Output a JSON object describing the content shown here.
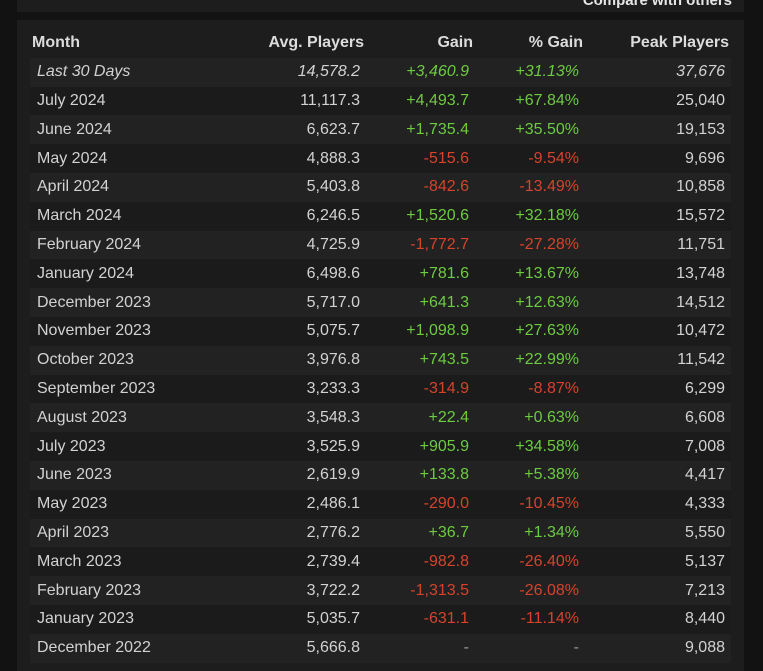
{
  "header_link": "Compare with others",
  "table": {
    "headers": {
      "month": "Month",
      "avg": "Avg. Players",
      "gain": "Gain",
      "pct": "% Gain",
      "peak": "Peak Players"
    },
    "rows": [
      {
        "month": "Last 30 Days",
        "avg": "14,578.2",
        "gain": "+3,460.9",
        "pct": "+31.13%",
        "peak": "37,676",
        "trend": "pos",
        "italic": true
      },
      {
        "month": "July 2024",
        "avg": "11,117.3",
        "gain": "+4,493.7",
        "pct": "+67.84%",
        "peak": "25,040",
        "trend": "pos"
      },
      {
        "month": "June 2024",
        "avg": "6,623.7",
        "gain": "+1,735.4",
        "pct": "+35.50%",
        "peak": "19,153",
        "trend": "pos"
      },
      {
        "month": "May 2024",
        "avg": "4,888.3",
        "gain": "-515.6",
        "pct": "-9.54%",
        "peak": "9,696",
        "trend": "neg"
      },
      {
        "month": "April 2024",
        "avg": "5,403.8",
        "gain": "-842.6",
        "pct": "-13.49%",
        "peak": "10,858",
        "trend": "neg"
      },
      {
        "month": "March 2024",
        "avg": "6,246.5",
        "gain": "+1,520.6",
        "pct": "+32.18%",
        "peak": "15,572",
        "trend": "pos"
      },
      {
        "month": "February 2024",
        "avg": "4,725.9",
        "gain": "-1,772.7",
        "pct": "-27.28%",
        "peak": "11,751",
        "trend": "neg"
      },
      {
        "month": "January 2024",
        "avg": "6,498.6",
        "gain": "+781.6",
        "pct": "+13.67%",
        "peak": "13,748",
        "trend": "pos"
      },
      {
        "month": "December 2023",
        "avg": "5,717.0",
        "gain": "+641.3",
        "pct": "+12.63%",
        "peak": "14,512",
        "trend": "pos"
      },
      {
        "month": "November 2023",
        "avg": "5,075.7",
        "gain": "+1,098.9",
        "pct": "+27.63%",
        "peak": "10,472",
        "trend": "pos"
      },
      {
        "month": "October 2023",
        "avg": "3,976.8",
        "gain": "+743.5",
        "pct": "+22.99%",
        "peak": "11,542",
        "trend": "pos"
      },
      {
        "month": "September 2023",
        "avg": "3,233.3",
        "gain": "-314.9",
        "pct": "-8.87%",
        "peak": "6,299",
        "trend": "neg"
      },
      {
        "month": "August 2023",
        "avg": "3,548.3",
        "gain": "+22.4",
        "pct": "+0.63%",
        "peak": "6,608",
        "trend": "pos"
      },
      {
        "month": "July 2023",
        "avg": "3,525.9",
        "gain": "+905.9",
        "pct": "+34.58%",
        "peak": "7,008",
        "trend": "pos"
      },
      {
        "month": "June 2023",
        "avg": "2,619.9",
        "gain": "+133.8",
        "pct": "+5.38%",
        "peak": "4,417",
        "trend": "pos"
      },
      {
        "month": "May 2023",
        "avg": "2,486.1",
        "gain": "-290.0",
        "pct": "-10.45%",
        "peak": "4,333",
        "trend": "neg"
      },
      {
        "month": "April 2023",
        "avg": "2,776.2",
        "gain": "+36.7",
        "pct": "+1.34%",
        "peak": "5,550",
        "trend": "pos"
      },
      {
        "month": "March 2023",
        "avg": "2,739.4",
        "gain": "-982.8",
        "pct": "-26.40%",
        "peak": "5,137",
        "trend": "neg"
      },
      {
        "month": "February 2023",
        "avg": "3,722.2",
        "gain": "-1,313.5",
        "pct": "-26.08%",
        "peak": "7,213",
        "trend": "neg"
      },
      {
        "month": "January 2023",
        "avg": "5,035.7",
        "gain": "-631.1",
        "pct": "-11.14%",
        "peak": "8,440",
        "trend": "neg"
      },
      {
        "month": "December 2022",
        "avg": "5,666.8",
        "gain": "-",
        "pct": "-",
        "peak": "9,088",
        "trend": "neutral"
      }
    ]
  },
  "colors": {
    "positive": "#6ccb40",
    "negative": "#d6432b",
    "background": "#1d1d1d"
  }
}
